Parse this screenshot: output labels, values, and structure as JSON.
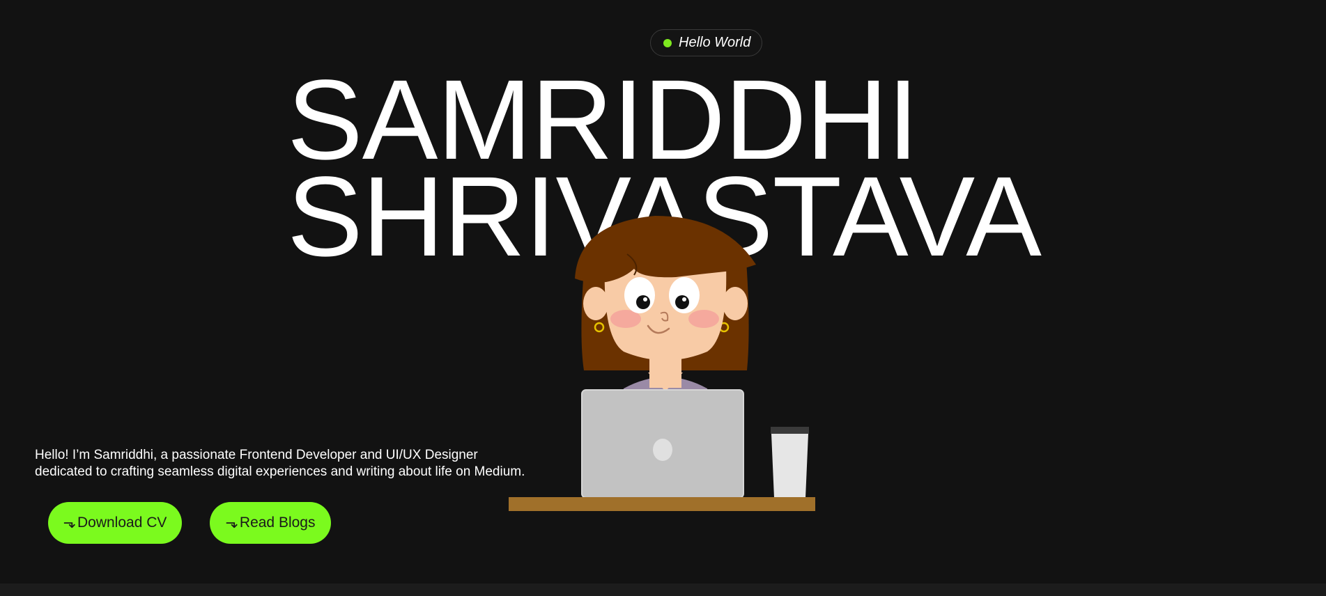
{
  "hero": {
    "badge_text": "Hello World",
    "name_line1": "SAMRIDDHI",
    "name_line2": "SHRIVASTAVA",
    "intro_line1": "Hello! I’m Samriddhi, a passionate Frontend Developer and UI/UX Designer",
    "intro_line2": "dedicated to crafting seamless digital experiences and writing about life on Medium.",
    "arrow_glyph": "⬎",
    "download_cv_label": "Download CV",
    "read_blogs_label": "Read Blogs"
  },
  "illustration": {
    "icon": "girl-with-laptop-illustration"
  },
  "colors": {
    "background": "#121212",
    "accent": "#7bfa1e",
    "badge_dot": "#7ee81f",
    "text": "#ffffff"
  }
}
